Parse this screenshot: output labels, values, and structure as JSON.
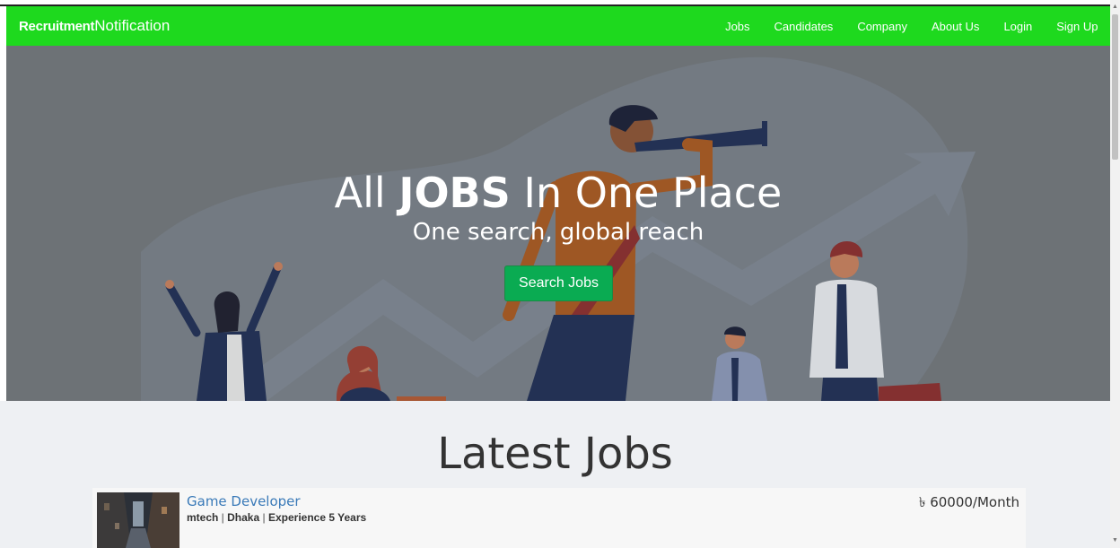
{
  "navbar": {
    "brand_bold": "Recruitment",
    "brand_normal": "Notification",
    "links": [
      "Jobs",
      "Candidates",
      "Company",
      "About Us",
      "Login",
      "Sign Up"
    ]
  },
  "hero": {
    "title_prefix": "All ",
    "title_bold": "JOBS",
    "title_suffix": " In One Place",
    "subtitle": "One search, global reach",
    "button_label": "Search Jobs"
  },
  "latest": {
    "heading": "Latest Jobs",
    "jobs": [
      {
        "title": "Game Developer",
        "company": "mtech",
        "location": "Dhaka",
        "experience": "Experience 5 Years",
        "salary": "৳ 60000/Month"
      }
    ]
  },
  "colors": {
    "navbar": "#1ed91e",
    "button": "#0aab52",
    "link": "#3a7ab8"
  }
}
